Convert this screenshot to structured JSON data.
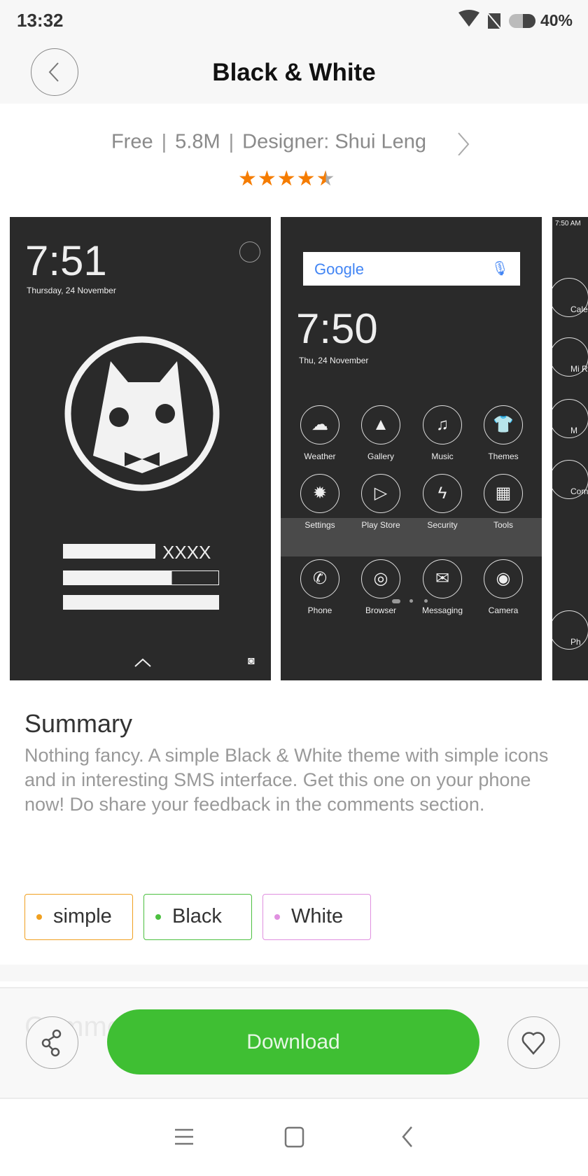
{
  "status": {
    "time": "13:32",
    "battery": "40%"
  },
  "header": {
    "title": "Black & White"
  },
  "info": {
    "price": "Free",
    "size": "5.8M",
    "designer": "Designer: Shui Leng",
    "rating": 4.5
  },
  "previews": [
    {
      "time": "7:51",
      "date": "Thursday, 24 November",
      "password_mask": "XXXX"
    },
    {
      "search": "Google",
      "time": "7:50",
      "date": "Thu, 24 November",
      "apps": [
        "Weather",
        "Gallery",
        "Music",
        "Themes",
        "Settings",
        "Play Store",
        "Security",
        "Tools"
      ],
      "dock": [
        "Phone",
        "Browser",
        "Messaging",
        "Camera"
      ]
    },
    {
      "time": "7:50 AM",
      "labels": [
        "Cale",
        "Mi Ro",
        "M",
        "Com",
        "Ph"
      ]
    }
  ],
  "summary": {
    "title": "Summary",
    "text": "Nothing fancy. A simple Black & White theme with simple icons and in interesting SMS interface. Get this one on your phone now! Do share your feedback in the comments section."
  },
  "tags": [
    {
      "label": "simple",
      "color": "#f0a020"
    },
    {
      "label": "Black",
      "color": "#4cc040"
    },
    {
      "label": "White",
      "color": "#e090e0"
    }
  ],
  "comments_label": "Comments",
  "actions": {
    "download": "Download",
    "accent": "#3fbf33"
  }
}
